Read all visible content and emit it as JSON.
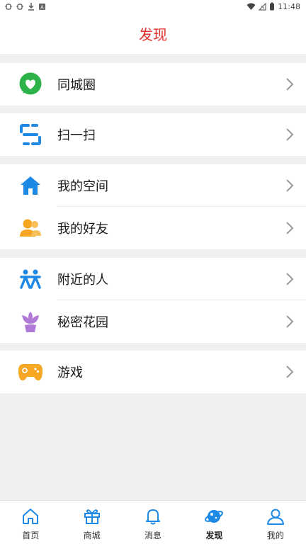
{
  "status_bar": {
    "time": "11:48",
    "left_icons": [
      "bug-icon",
      "bug-icon",
      "download-icon",
      "app-icon"
    ],
    "right_icons": [
      "wifi-icon",
      "signal-icon",
      "battery-icon"
    ]
  },
  "header": {
    "title": "发现"
  },
  "groups": [
    {
      "items": [
        {
          "label": "同城圈",
          "icon": "chat-heart-icon",
          "color": "#2db34a"
        }
      ]
    },
    {
      "items": [
        {
          "label": "扫一扫",
          "icon": "scan-icon",
          "color": "#1e88e5"
        }
      ]
    },
    {
      "items": [
        {
          "label": "我的空间",
          "icon": "home-icon",
          "color": "#1e88e5"
        },
        {
          "label": "我的好友",
          "icon": "friends-icon",
          "color": "#f5a623"
        }
      ]
    },
    {
      "items": [
        {
          "label": "附近的人",
          "icon": "nearby-people-icon",
          "color": "#1e88e5"
        },
        {
          "label": "秘密花园",
          "icon": "flower-icon",
          "color": "#b07ad8"
        }
      ]
    },
    {
      "items": [
        {
          "label": "游戏",
          "icon": "gamepad-icon",
          "color": "#f5a623"
        }
      ]
    }
  ],
  "tabbar": {
    "tabs": [
      {
        "label": "首页",
        "icon": "home-outline-icon"
      },
      {
        "label": "商城",
        "icon": "gift-icon"
      },
      {
        "label": "消息",
        "icon": "bell-icon"
      },
      {
        "label": "发现",
        "icon": "planet-icon",
        "active": true
      },
      {
        "label": "我的",
        "icon": "user-icon"
      }
    ],
    "accent": "#1e88e5"
  }
}
